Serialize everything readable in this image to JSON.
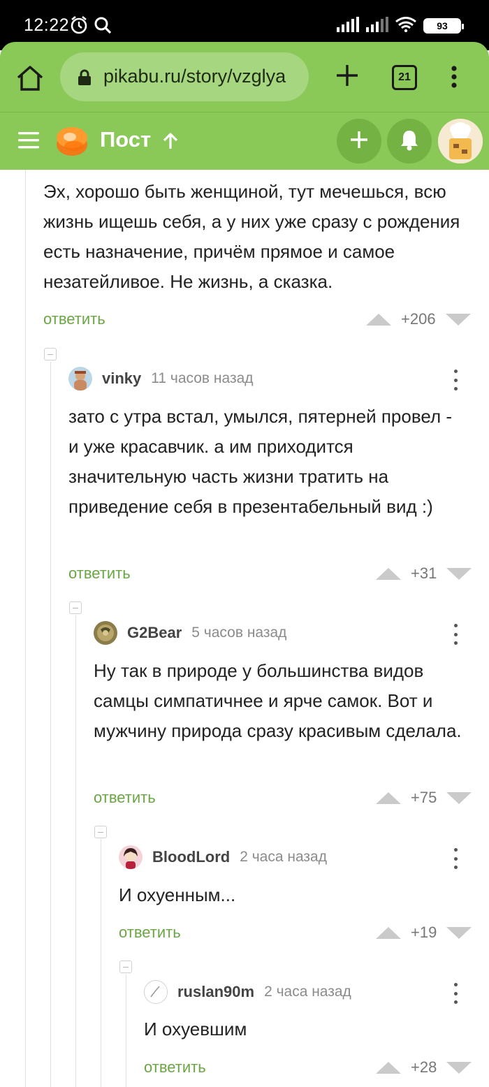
{
  "status": {
    "time": "12:22",
    "battery": "93"
  },
  "browser": {
    "url": "pikabu.ru/story/vzglya",
    "tab_count": "21"
  },
  "header": {
    "title": "Пост"
  },
  "comments": [
    {
      "text": "Эх, хорошо быть женщиной, тут мечешься, всю жизнь ищешь себя, а у них уже сразу с рождения есть назначение, причём прямое и самое незатейливое. Не жизнь, а сказка.",
      "reply": "ответить",
      "score": "+206"
    },
    {
      "user": "vinky",
      "time": "11 часов назад",
      "text": "зато с утра встал, умылся, пятерней провел - и уже красавчик. а им приходится значительную часть жизни тратить на приведение себя в презентабельный вид :)",
      "reply": "ответить",
      "score": "+31"
    },
    {
      "user": "G2Bear",
      "time": "5 часов назад",
      "text": "Ну так в природе у большинства видов самцы симпатичнее и ярче самок. Вот и мужчину природа сразу красивым сделала.",
      "reply": "ответить",
      "score": "+75"
    },
    {
      "user": "BloodLord",
      "time": "2 часа назад",
      "text": "И охуенным...",
      "reply": "ответить",
      "score": "+19"
    },
    {
      "user": "ruslan90m",
      "time": "2 часа назад",
      "text": "И охуевшим",
      "reply": "ответить",
      "score": "+28"
    }
  ],
  "icons": {
    "status_left": [
      "alarm-icon",
      "search-icon"
    ],
    "status_right": [
      "signal-icon",
      "signal-icon",
      "wifi-icon",
      "battery-icon"
    ],
    "browser": [
      "home-icon",
      "lock-icon",
      "new-tab-icon",
      "tabs-icon",
      "more-icon"
    ],
    "header": [
      "menu-icon",
      "pikabu-logo",
      "arrow-up-icon",
      "add-icon",
      "bell-icon",
      "avatar"
    ]
  },
  "colors": {
    "accent": "#8ac858",
    "reply": "#6aa644",
    "vote": "#cacaca"
  }
}
